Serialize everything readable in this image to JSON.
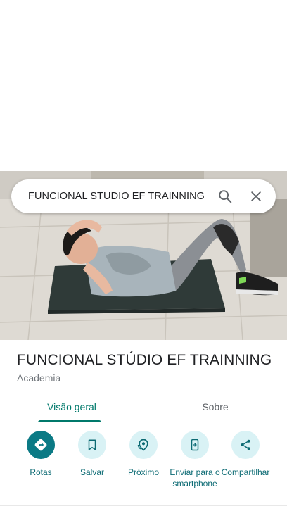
{
  "search": {
    "query": "FUNCIONAL STÚDIO EF TRAINNING",
    "icons": [
      "search-icon",
      "close-icon"
    ]
  },
  "place": {
    "title": "FUNCIONAL STÚDIO EF TRAINNING",
    "category": "Academia"
  },
  "tabs": [
    {
      "label": "Visão geral",
      "active": true
    },
    {
      "label": "Sobre",
      "active": false
    }
  ],
  "actions": [
    {
      "label": "Rotas",
      "icon": "directions-icon"
    },
    {
      "label": "Salvar",
      "icon": "bookmark-icon"
    },
    {
      "label": "Próximo",
      "icon": "nearby-icon"
    },
    {
      "label": "Enviar para o smartphone",
      "icon": "send-to-phone-icon"
    },
    {
      "label": "Compartilhar",
      "icon": "share-icon"
    }
  ],
  "colors": {
    "accent": "#00796b",
    "action_primary": "#0b7a85",
    "action_bg": "#d9f2f5"
  }
}
